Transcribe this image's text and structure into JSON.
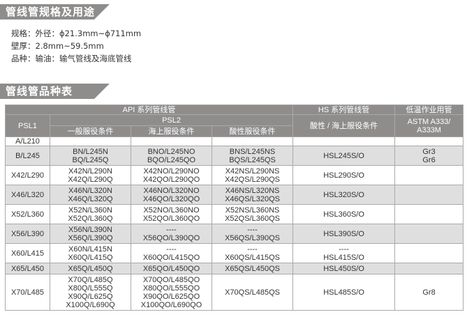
{
  "section1": {
    "title": "管线管规格及用途"
  },
  "specs": [
    "规格：外径：ϕ21.3mm~ϕ711mm",
    "壁厚：2.8mm~59.5mm",
    "品种：输油：输气管线及海底管线"
  ],
  "section2": {
    "title": "管线管品种表"
  },
  "table": {
    "api_header": "API 系列管线管",
    "psl1": "PSL1",
    "psl2": "PSL2",
    "psl2_cols": [
      "一般服役条件",
      "海上服役条件",
      "酸性服役条件"
    ],
    "hs_header": "HS 系列管线管",
    "hs_sub": "酸性 / 海上服役条件",
    "low_header": "低温作业用管",
    "low_sub": "ASTM  A333/ A333M",
    "rows": [
      {
        "psl1": "A/L210",
        "gen": "",
        "off": "",
        "sour": "",
        "hs": "",
        "low": ""
      },
      {
        "psl1": "B/L245",
        "gen": [
          "BN/L245N",
          "BQ/L245Q"
        ],
        "off": [
          "BNO/L245NO",
          "BQO/L245QO"
        ],
        "sour": [
          "BNS/L245NS",
          "BQS/L245QS"
        ],
        "hs": "HSL245S/O",
        "low": [
          "Gr3",
          "Gr6"
        ]
      },
      {
        "psl1": "X42/L290",
        "gen": [
          "X42N/L290N",
          "X42Q/L290Q"
        ],
        "off": [
          "X42NO/L290NO",
          "X42QO/L290QO"
        ],
        "sour": [
          "X42NS/L290NS",
          "X42QS/L290QS"
        ],
        "hs": "HSL290S/O",
        "low": ""
      },
      {
        "psl1": "X46/L320",
        "gen": [
          "X46N/L320N",
          "X46Q/L320Q"
        ],
        "off": [
          "X46NO/L320NO",
          "X46QO/L320QO"
        ],
        "sour": [
          "X46NS/L320NS",
          "X46QS/L320QS"
        ],
        "hs": "HSL320S/O",
        "low": ""
      },
      {
        "psl1": "X52/L360",
        "gen": [
          "X52N/L360N",
          "X52Q/L360Q"
        ],
        "off": [
          "X52NO/L360NO",
          "X52QO/L360QO"
        ],
        "sour": [
          "X52NS/L360NS",
          "X52QS/L360QS"
        ],
        "hs": "HSL360S/O",
        "low": ""
      },
      {
        "psl1": "X56/L390",
        "gen": [
          "X56N/L390N",
          "X56Q/L390Q"
        ],
        "off": [
          "----",
          "X56QO/L390QO"
        ],
        "sour": [
          "----",
          "X56QS/L390QS"
        ],
        "hs": "HSL390S/O",
        "low": ""
      },
      {
        "psl1": "X60/L415",
        "gen": [
          "X60N/L415N",
          "X60Q/L415Q"
        ],
        "off": [
          "----",
          "X60QO/L415QO"
        ],
        "sour": [
          "----",
          "X60QS/L415QS"
        ],
        "hs": [
          "----",
          "HSL415S/O"
        ],
        "low": ""
      },
      {
        "psl1": "X65/L450",
        "gen": "X65Q/L450Q",
        "off": "X65QO/L450QO",
        "sour": "X65QS/L450QS",
        "hs": "HSL450S/O",
        "low": ""
      },
      {
        "psl1": "X70/L485",
        "gen": [
          "X70Q/L485Q",
          "X80Q/L555Q",
          "X90Q/L625Q",
          "X100Q/L690Q"
        ],
        "off": [
          "X70QO/L485QO",
          "X80QO/L555QO",
          "X90QO/L625QO",
          "X100QO/L690QO"
        ],
        "sour": "X70QS/L485QS",
        "hs": "HSL485S/O",
        "low": "Gr8"
      }
    ]
  }
}
